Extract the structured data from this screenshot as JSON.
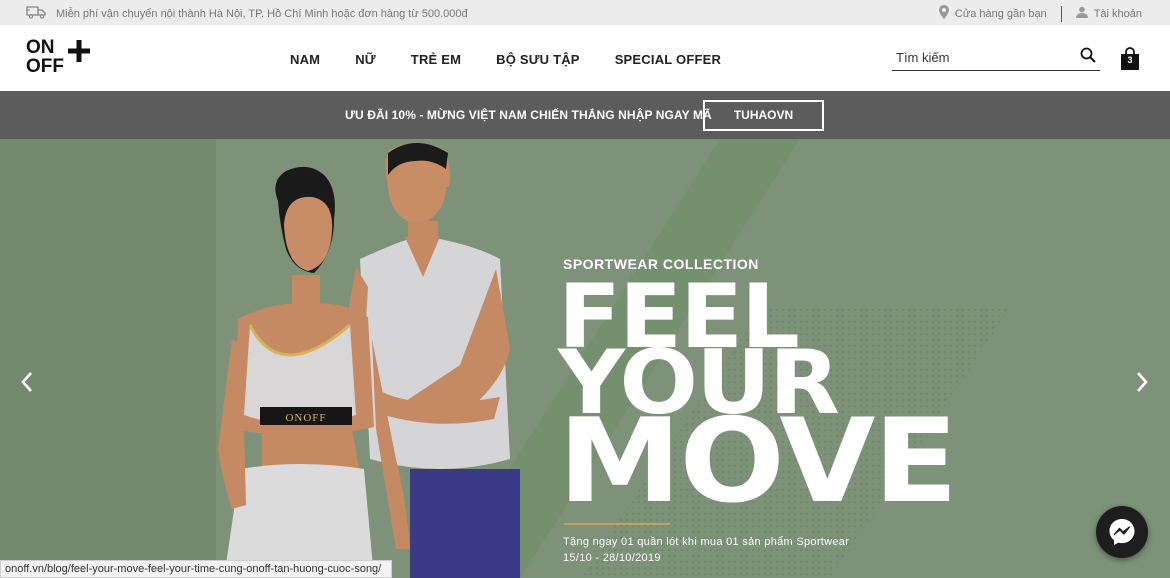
{
  "topbar": {
    "shipping_text": "Miễn phí vận chuyển nội thành Hà Nội, TP. Hồ Chí Minh hoặc đơn hàng từ 500.000đ",
    "store_link": "Cửa hàng gần bạn",
    "account_link": "Tài khoản"
  },
  "header": {
    "logo_line1": "ON",
    "logo_line2": "OFF",
    "nav": [
      "NAM",
      "NỮ",
      "TRẺ EM",
      "BỘ SƯU TẬP",
      "SPECIAL OFFER"
    ],
    "search_placeholder": "Tìm kiếm",
    "cart_count": "3"
  },
  "promo": {
    "text": "ƯU ĐÃI 10% - MỪNG VIỆT NAM CHIẾN THẮNG NHẬP NGAY MÃ",
    "code": "TUHAOVN"
  },
  "hero": {
    "subtitle": "SPORTWEAR COLLECTION",
    "line1": "FEEL",
    "line2": "YOUR",
    "line3": "MOVE",
    "offer": "Tặng ngay 01 quần lót khi mua 01 sản phẩm Sportwear",
    "dates": "15/10 - 28/10/2019",
    "bra_label": "ONOFF"
  },
  "status_url": "onoff.vn/blog/feel-your-move-feel-your-time-cung-onoff-tan-huong-cuoc-song/",
  "colors": {
    "hero_bg": "#7d9279",
    "promo_bg": "#5c5c5c",
    "accent_gold": "#c2a15a"
  }
}
